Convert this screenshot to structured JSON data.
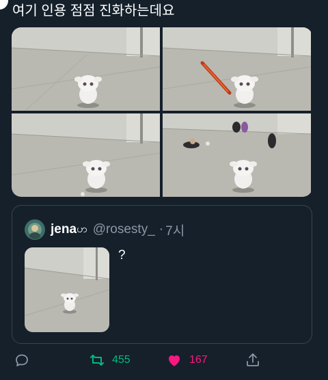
{
  "tweet": {
    "text": "여기 인용 점점 진화하는데요"
  },
  "media": {
    "photos": [
      {
        "label": "photo-1"
      },
      {
        "label": "photo-2"
      },
      {
        "label": "photo-3"
      },
      {
        "label": "photo-4"
      }
    ]
  },
  "quote": {
    "name": "jena",
    "name_glyph": "ဟ",
    "handle": "@rosesty_",
    "separator": "·",
    "time": "7시",
    "text": "?"
  },
  "actions": {
    "reply_icon": "reply-icon",
    "retweet_icon": "retweet-icon",
    "retweet_count": "455",
    "like_icon": "heart-icon",
    "like_count": "167",
    "share_icon": "share-icon"
  },
  "colors": {
    "background": "#15202b",
    "border": "#38444d",
    "secondary_text": "#8b98a5",
    "retweet_green": "#00ba7c",
    "like_pink": "#f91880"
  }
}
